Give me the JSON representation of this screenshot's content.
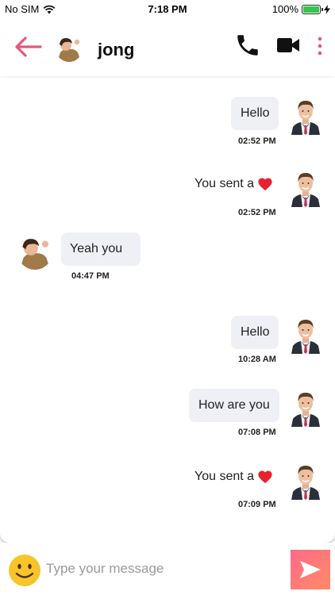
{
  "status_bar": {
    "carrier": "No SIM",
    "time": "7:18 PM",
    "battery": "100%",
    "battery_level": 1.0
  },
  "header": {
    "contact_name": "jong",
    "icons": {
      "back": "back-arrow-icon",
      "call": "phone-icon",
      "video": "video-camera-icon",
      "more": "more-vertical-icon"
    },
    "accent_color": "#e8577a"
  },
  "messages": [
    {
      "side": "right",
      "type": "bubble",
      "text": "Hello",
      "time": "02:52 PM"
    },
    {
      "side": "right",
      "type": "like",
      "text": "You sent a",
      "time": "02:52 PM"
    },
    {
      "side": "left",
      "type": "bubble",
      "text": "Yeah you",
      "time": "04:47 PM"
    },
    {
      "side": "right",
      "type": "bubble",
      "text": "Hello",
      "time": "10:28 AM"
    },
    {
      "side": "right",
      "type": "bubble",
      "text": "How are you",
      "time": "07:08 PM"
    },
    {
      "side": "right",
      "type": "like",
      "text": "You sent a",
      "time": "07:09 PM"
    }
  ],
  "input": {
    "placeholder": "Type your message",
    "value": ""
  },
  "colors": {
    "bubble_bg": "#eff0f5",
    "send_gradient_start": "#ff6a8a",
    "send_gradient_end": "#ff8a66",
    "heart": "#e8212e",
    "emoji": "#f7c52b"
  }
}
